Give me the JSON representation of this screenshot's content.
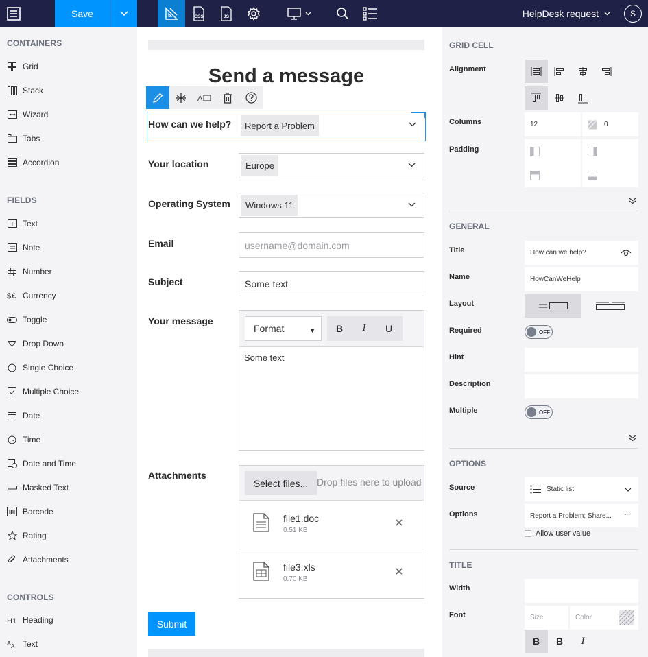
{
  "topbar": {
    "save_label": "Save",
    "form_name": "HelpDesk request",
    "avatar_initial": "S",
    "css_label": "CSS",
    "js_label": "JS"
  },
  "left_panel": {
    "containers_title": "CONTAINERS",
    "containers": [
      {
        "label": "Grid",
        "icon": "grid-icon"
      },
      {
        "label": "Stack",
        "icon": "stack-icon"
      },
      {
        "label": "Wizard",
        "icon": "wizard-icon"
      },
      {
        "label": "Tabs",
        "icon": "tabs-icon"
      },
      {
        "label": "Accordion",
        "icon": "accordion-icon"
      }
    ],
    "fields_title": "FIELDS",
    "fields": [
      {
        "label": "Text",
        "icon": "text-field-icon"
      },
      {
        "label": "Note",
        "icon": "note-icon"
      },
      {
        "label": "Number",
        "icon": "hash-icon"
      },
      {
        "label": "Currency",
        "icon": "currency-icon"
      },
      {
        "label": "Toggle",
        "icon": "toggle-icon"
      },
      {
        "label": "Drop Down",
        "icon": "dropdown-icon"
      },
      {
        "label": "Single Choice",
        "icon": "radio-icon"
      },
      {
        "label": "Multiple Choice",
        "icon": "checkbox-icon"
      },
      {
        "label": "Date",
        "icon": "calendar-icon"
      },
      {
        "label": "Time",
        "icon": "clock-icon"
      },
      {
        "label": "Date and Time",
        "icon": "date-time-icon"
      },
      {
        "label": "Masked Text",
        "icon": "masked-text-icon"
      },
      {
        "label": "Barcode",
        "icon": "barcode-icon"
      },
      {
        "label": "Rating",
        "icon": "star-icon"
      },
      {
        "label": "Attachments",
        "icon": "paperclip-icon"
      }
    ],
    "controls_title": "CONTROLS",
    "controls": [
      {
        "label": "Heading",
        "icon": "heading-icon"
      },
      {
        "label": "Text",
        "icon": "text-control-icon"
      }
    ]
  },
  "form": {
    "title": "Send a message",
    "help_label": "How can we help?",
    "help_value": "Report a Problem",
    "location_label": "Your location",
    "location_value": "Europe",
    "os_label": "Operating System",
    "os_value": "Windows 11",
    "email_label": "Email",
    "email_placeholder": "username@domain.com",
    "subject_label": "Subject",
    "subject_value": "Some text",
    "message_label": "Your message",
    "format_label": "Format",
    "bold": "B",
    "italic": "I",
    "underline": "U",
    "message_value": "Some text",
    "attachments_label": "Attachments",
    "select_files": "Select files...",
    "drop_text": "Drop files here to upload",
    "files": [
      {
        "name": "file1.doc",
        "size": "0.51 KB"
      },
      {
        "name": "file3.xls",
        "size": "0.70 KB"
      }
    ],
    "submit": "Submit",
    "toolbar_text_label": "A"
  },
  "right_panel": {
    "grid_cell_title": "GRID CELL",
    "alignment_label": "Alignment",
    "columns_label": "Columns",
    "columns_value": "12",
    "offset_value": "0",
    "padding_label": "Padding",
    "general_title": "GENERAL",
    "title_label": "Title",
    "title_value": "How can we help?",
    "name_label": "Name",
    "name_value": "HowCanWeHelp",
    "layout_label": "Layout",
    "required_label": "Required",
    "required_state": "OFF",
    "hint_label": "Hint",
    "description_label": "Description",
    "multiple_label": "Multiple",
    "multiple_state": "OFF",
    "options_title": "OPTIONS",
    "source_label": "Source",
    "source_value": "Static list",
    "options_label": "Options",
    "options_value": "Report a Problem; Share...",
    "options_more": "...",
    "allow_user_value": "Allow user value",
    "title_section": "TITLE",
    "width_label": "Width",
    "font_label": "Font",
    "size_placeholder": "Size",
    "color_placeholder": "Color",
    "bold": "B",
    "italic": "I"
  },
  "colors": {
    "topbar": "#1f2147",
    "accent": "#0094ff",
    "selection": "#2a94e6"
  }
}
